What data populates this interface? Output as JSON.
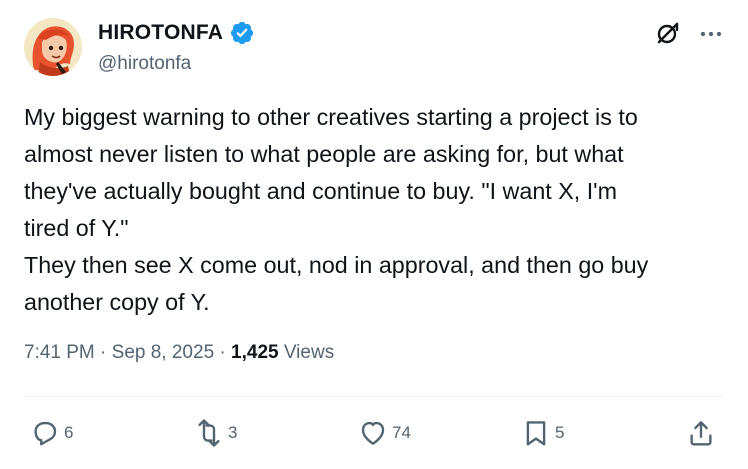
{
  "author": {
    "display_name": "HIROTONFA",
    "handle": "@hirotonfa",
    "verified": true
  },
  "tweet": {
    "text": "My biggest warning to other creatives starting a project is to\nalmost never listen to what people are asking for, but what\nthey've actually bought and continue to buy. \"I want X, I'm\ntired of Y.\"\nThey then see X come out, nod in approval, and then go buy\nanother copy of Y."
  },
  "meta": {
    "time": "7:41 PM",
    "separator": " · ",
    "date": "Sep 8, 2025",
    "separator2": " · ",
    "views_count": "1,425",
    "views_label": " Views"
  },
  "actions": {
    "replies": "6",
    "reposts": "3",
    "likes": "74",
    "bookmarks": "5"
  },
  "icons": [
    "avatar",
    "verified-badge-icon",
    "grok-icon",
    "more-icon",
    "reply-icon",
    "repost-icon",
    "like-icon",
    "bookmark-icon",
    "share-icon"
  ],
  "colors": {
    "text": "#0f1419",
    "secondary": "#536471",
    "verified": "#1d9bf0",
    "divider": "#eff3f4"
  }
}
